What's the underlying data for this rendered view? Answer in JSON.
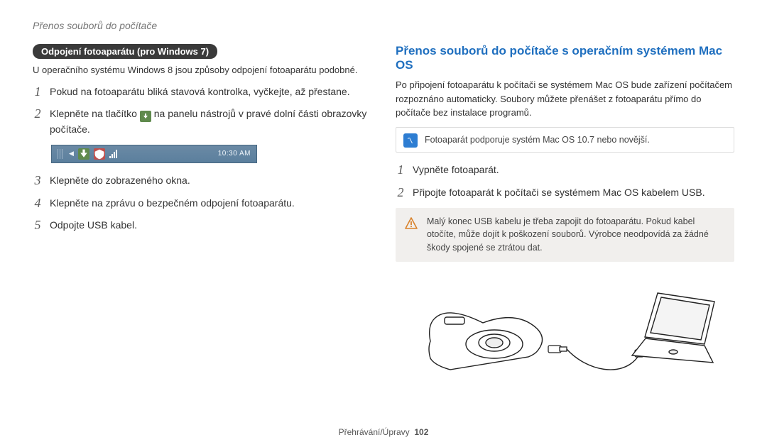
{
  "page_header": "Přenos souborů do počítače",
  "left": {
    "badge": "Odpojení fotoaparátu (pro Windows 7)",
    "intro": "U operačního systému Windows 8 jsou způsoby odpojení fotoaparátu podobné.",
    "steps": {
      "1": "Pokud na fotoaparátu bliká stavová kontrolka, vyčkejte, až přestane.",
      "2a": "Klepněte na tlačítko ",
      "2b": " na panelu nástrojů v pravé dolní části obrazovky počítače.",
      "3": "Klepněte do zobrazeného okna.",
      "4": "Klepněte na zprávu o bezpečném odpojení fotoaparátu.",
      "5": "Odpojte USB kabel."
    },
    "taskbar_clock": "10:30 AM"
  },
  "right": {
    "title": "Přenos souborů do počítače s operačním systémem Mac OS",
    "intro": "Po připojení fotoaparátu k počítači se systémem Mac OS bude zařízení počítačem rozpoznáno automaticky. Soubory můžete přenášet z fotoaparátu přímo do počítače bez instalace programů.",
    "note": "Fotoaparát podporuje systém Mac OS 10.7 nebo novější.",
    "steps": {
      "1": "Vypněte fotoaparát.",
      "2": "Připojte fotoaparát k počítači se systémem Mac OS kabelem USB."
    },
    "warn": "Malý konec USB kabelu je třeba zapojit do fotoaparátu. Pokud kabel otočíte, může dojít k poškození souborů. Výrobce neodpovídá za žádné škody spojené se ztrátou dat."
  },
  "footer": {
    "section": "Přehrávání/Úpravy",
    "page": "102"
  }
}
